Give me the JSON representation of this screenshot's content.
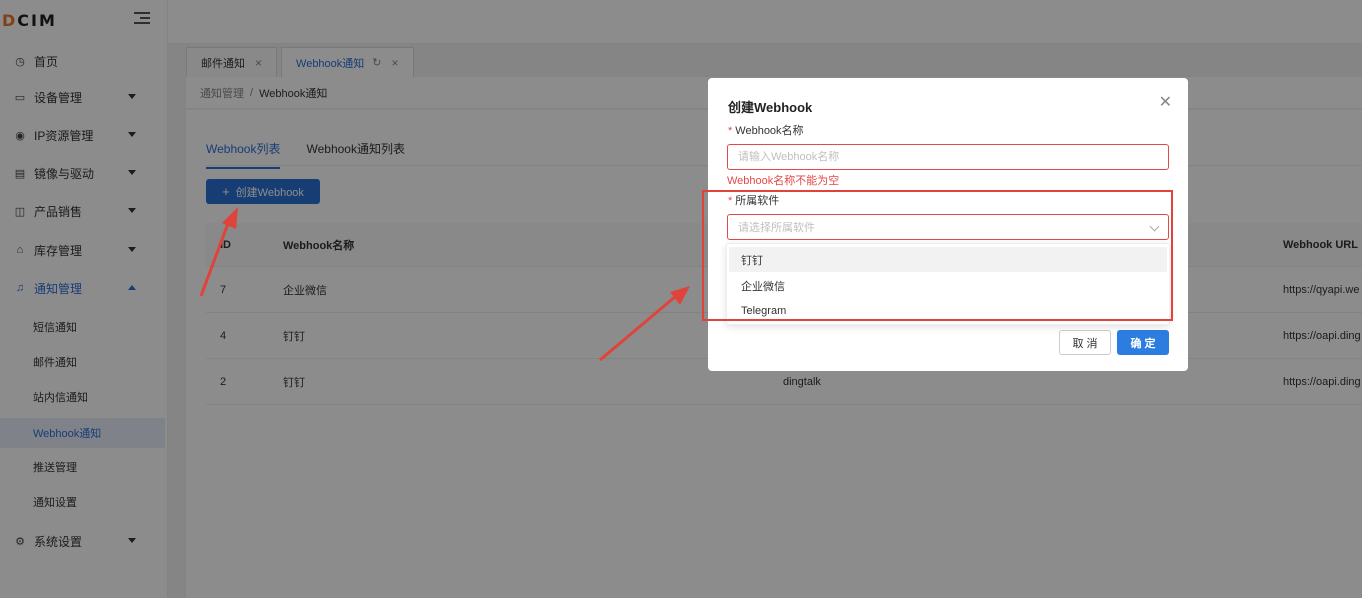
{
  "app": {
    "logo": "DCIM"
  },
  "sidebar": {
    "menu": [
      {
        "label": "首页",
        "icon": "dashboard-icon"
      },
      {
        "label": "设备管理",
        "icon": "monitor-icon"
      },
      {
        "label": "IP资源管理",
        "icon": "network-icon"
      },
      {
        "label": "镜像与驱动",
        "icon": "document-icon"
      },
      {
        "label": "产品销售",
        "icon": "bag-icon"
      },
      {
        "label": "库存管理",
        "icon": "warehouse-icon"
      },
      {
        "label": "通知管理",
        "icon": "bell-icon"
      },
      {
        "label": "系统设置",
        "icon": "gear-icon"
      }
    ],
    "submenu": [
      "短信通知",
      "邮件通知",
      "站内信通知",
      "Webhook通知",
      "推送管理",
      "通知设置"
    ]
  },
  "tabs": [
    {
      "label": "邮件通知"
    },
    {
      "label": "Webhook通知"
    }
  ],
  "breadcrumb": {
    "parent": "通知管理",
    "separator": "/",
    "current": "Webhook通知"
  },
  "content": {
    "inner_tabs": [
      "Webhook列表",
      "Webhook通知列表"
    ],
    "create_button": "创建Webhook",
    "table": {
      "headers": {
        "id": "ID",
        "name": "Webhook名称",
        "url": "Webhook URL"
      },
      "rows": [
        {
          "id": "7",
          "name": "企业微信",
          "software": "",
          "url": "https://qyapi.we"
        },
        {
          "id": "4",
          "name": "钉钉",
          "software": "",
          "url": "https://oapi.ding"
        },
        {
          "id": "2",
          "name": "钉钉",
          "software": "dingtalk",
          "url": "https://oapi.ding"
        }
      ]
    }
  },
  "modal": {
    "title": "创建Webhook",
    "name_label": "Webhook名称",
    "name_placeholder": "请输入Webhook名称",
    "name_error": "Webhook名称不能为空",
    "software_label": "所属软件",
    "software_placeholder": "请选择所属软件",
    "software_options": [
      "钉钉",
      "企业微信",
      "Telegram"
    ],
    "cancel": "取 消",
    "ok": "确 定"
  },
  "colors": {
    "primary": "#2b6fd6",
    "error": "#e64848",
    "annotation": "#e0433a"
  }
}
